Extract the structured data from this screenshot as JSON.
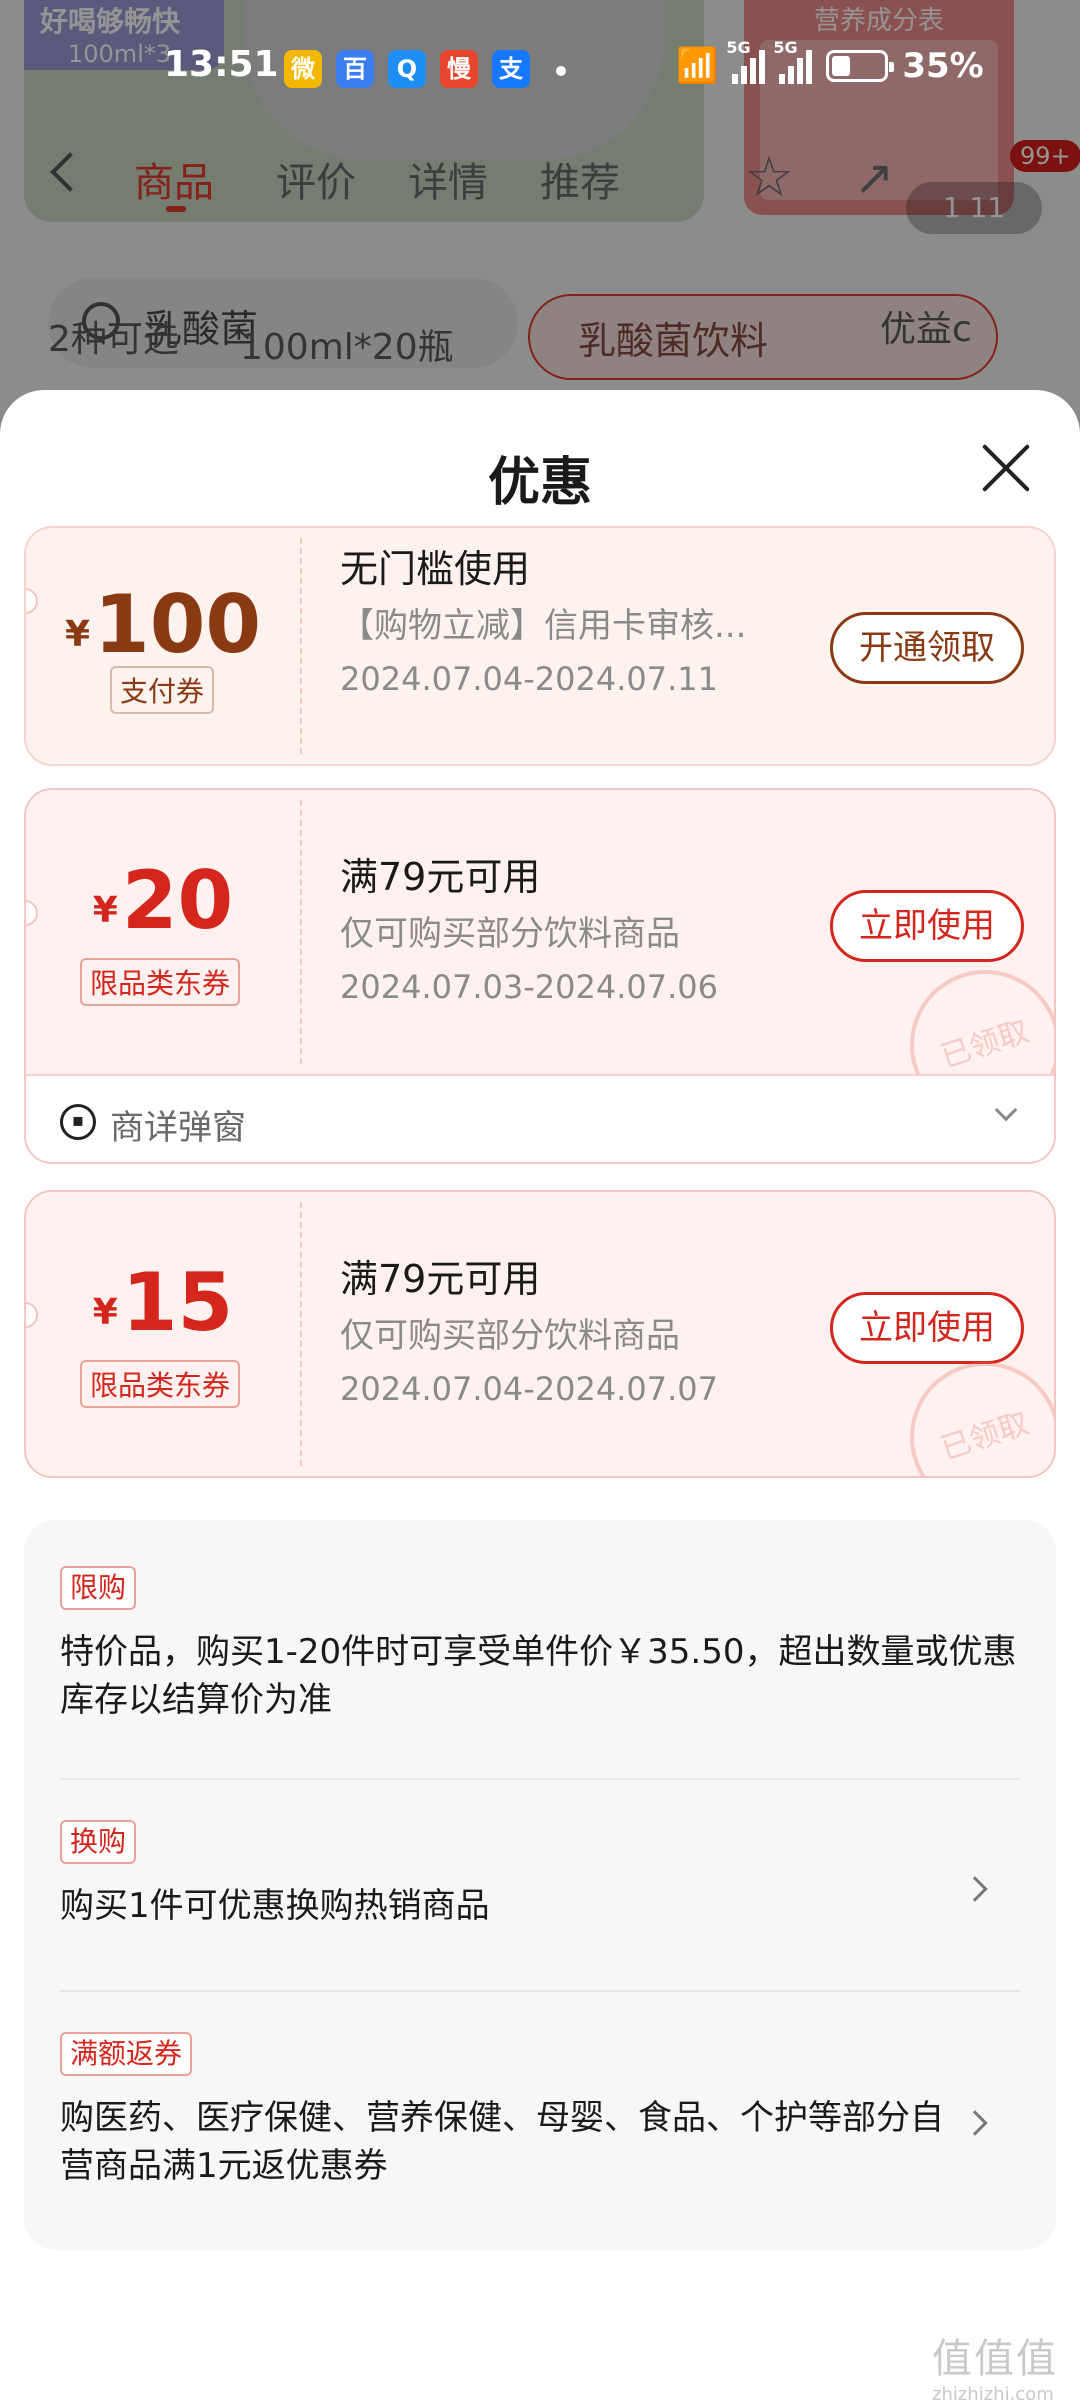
{
  "status_bar": {
    "time": "13:51",
    "app_icons": [
      {
        "icon": "weibo-icon",
        "glyph": "微",
        "color": "#f5b800"
      },
      {
        "icon": "baidu-icon",
        "glyph": "百",
        "color": "#3a7ef0"
      },
      {
        "icon": "search-app-icon",
        "glyph": "Q",
        "color": "#1e8ef5"
      },
      {
        "icon": "man-app-icon",
        "glyph": "慢",
        "color": "#e8452c"
      },
      {
        "icon": "alipay-icon",
        "glyph": "支",
        "color": "#1677ff"
      }
    ],
    "signal_tags": [
      "5G",
      "5G"
    ],
    "battery": "35%"
  },
  "background_page": {
    "hero_badge": "好喝够畅快",
    "hero_sub": "100ml*3",
    "nutrition_title": "营养成分表",
    "tabs": [
      "商品",
      "评价",
      "详情",
      "推荐"
    ],
    "notification_badge": "99+",
    "image_counter": "1 11",
    "search_text": "乳酸菌",
    "chip_text": "乳酸菌饮料",
    "option_left": "2种可选",
    "option_sub": "100ml*20瓶",
    "option_right": "优益c"
  },
  "sheet": {
    "title": "优惠",
    "coupons": [
      {
        "currency": "¥",
        "amount": "100",
        "tag": "支付券",
        "title": "无门槛使用",
        "desc": "【购物立减】信用卡审核...",
        "date": "2024.07.04-2024.07.11",
        "button": "开通领取"
      },
      {
        "currency": "¥",
        "amount": "20",
        "tag": "限品类东券",
        "title": "满79元可用",
        "desc": "仅可购买部分饮料商品",
        "date": "2024.07.03-2024.07.06",
        "button": "立即使用",
        "stamp": "已领取",
        "footer": "商详弹窗"
      },
      {
        "currency": "¥",
        "amount": "15",
        "tag": "限品类东券",
        "title": "满79元可用",
        "desc": "仅可购买部分饮料商品",
        "date": "2024.07.04-2024.07.07",
        "button": "立即使用",
        "stamp": "已领取"
      }
    ],
    "promotions": [
      {
        "tag": "限购",
        "text": "特价品，购买1-20件时可享受单件价￥35.50，超出数量或优惠库存以结算价为准"
      },
      {
        "tag": "换购",
        "text": "购买1件可优惠换购热销商品"
      },
      {
        "tag": "满额返券",
        "text": "购医药、医疗保健、营养保健、母婴、食品、个护等部分自营商品满1元返优惠券"
      }
    ]
  },
  "watermark": {
    "big": "值值值",
    "small": "zhizhizhi.com"
  },
  "colors": {
    "accent_red": "#d5261d",
    "coupon_brown": "#8a3a12",
    "coupon_bg": "#fef1ef"
  }
}
